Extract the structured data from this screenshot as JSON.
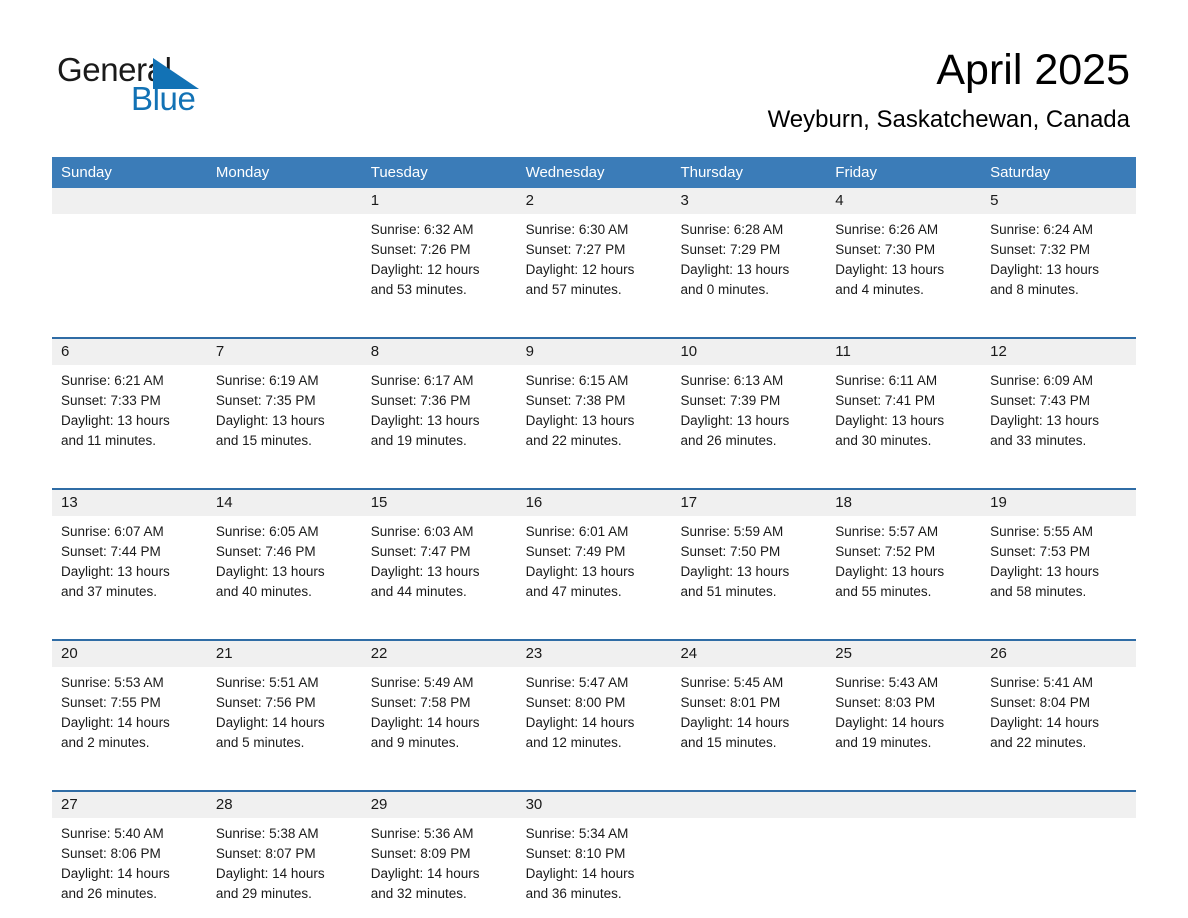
{
  "logo": {
    "word_one": "General",
    "word_two": "Blue",
    "triangle_color": "#1272b5",
    "text_color": "#1a1a1a"
  },
  "header": {
    "title": "April 2025",
    "location": "Weyburn, Saskatchewan, Canada"
  },
  "colors": {
    "header_band": "#3b7cb8",
    "row_divider": "#2f6ca5",
    "day_number_band": "#f0f0f0",
    "text": "#1a1a1a"
  },
  "weekdays": [
    "Sunday",
    "Monday",
    "Tuesday",
    "Wednesday",
    "Thursday",
    "Friday",
    "Saturday"
  ],
  "weeks": [
    [
      {
        "day": "",
        "lines": []
      },
      {
        "day": "",
        "lines": []
      },
      {
        "day": "1",
        "lines": [
          "Sunrise: 6:32 AM",
          "Sunset: 7:26 PM",
          "Daylight: 12 hours",
          "and 53 minutes."
        ]
      },
      {
        "day": "2",
        "lines": [
          "Sunrise: 6:30 AM",
          "Sunset: 7:27 PM",
          "Daylight: 12 hours",
          "and 57 minutes."
        ]
      },
      {
        "day": "3",
        "lines": [
          "Sunrise: 6:28 AM",
          "Sunset: 7:29 PM",
          "Daylight: 13 hours",
          "and 0 minutes."
        ]
      },
      {
        "day": "4",
        "lines": [
          "Sunrise: 6:26 AM",
          "Sunset: 7:30 PM",
          "Daylight: 13 hours",
          "and 4 minutes."
        ]
      },
      {
        "day": "5",
        "lines": [
          "Sunrise: 6:24 AM",
          "Sunset: 7:32 PM",
          "Daylight: 13 hours",
          "and 8 minutes."
        ]
      }
    ],
    [
      {
        "day": "6",
        "lines": [
          "Sunrise: 6:21 AM",
          "Sunset: 7:33 PM",
          "Daylight: 13 hours",
          "and 11 minutes."
        ]
      },
      {
        "day": "7",
        "lines": [
          "Sunrise: 6:19 AM",
          "Sunset: 7:35 PM",
          "Daylight: 13 hours",
          "and 15 minutes."
        ]
      },
      {
        "day": "8",
        "lines": [
          "Sunrise: 6:17 AM",
          "Sunset: 7:36 PM",
          "Daylight: 13 hours",
          "and 19 minutes."
        ]
      },
      {
        "day": "9",
        "lines": [
          "Sunrise: 6:15 AM",
          "Sunset: 7:38 PM",
          "Daylight: 13 hours",
          "and 22 minutes."
        ]
      },
      {
        "day": "10",
        "lines": [
          "Sunrise: 6:13 AM",
          "Sunset: 7:39 PM",
          "Daylight: 13 hours",
          "and 26 minutes."
        ]
      },
      {
        "day": "11",
        "lines": [
          "Sunrise: 6:11 AM",
          "Sunset: 7:41 PM",
          "Daylight: 13 hours",
          "and 30 minutes."
        ]
      },
      {
        "day": "12",
        "lines": [
          "Sunrise: 6:09 AM",
          "Sunset: 7:43 PM",
          "Daylight: 13 hours",
          "and 33 minutes."
        ]
      }
    ],
    [
      {
        "day": "13",
        "lines": [
          "Sunrise: 6:07 AM",
          "Sunset: 7:44 PM",
          "Daylight: 13 hours",
          "and 37 minutes."
        ]
      },
      {
        "day": "14",
        "lines": [
          "Sunrise: 6:05 AM",
          "Sunset: 7:46 PM",
          "Daylight: 13 hours",
          "and 40 minutes."
        ]
      },
      {
        "day": "15",
        "lines": [
          "Sunrise: 6:03 AM",
          "Sunset: 7:47 PM",
          "Daylight: 13 hours",
          "and 44 minutes."
        ]
      },
      {
        "day": "16",
        "lines": [
          "Sunrise: 6:01 AM",
          "Sunset: 7:49 PM",
          "Daylight: 13 hours",
          "and 47 minutes."
        ]
      },
      {
        "day": "17",
        "lines": [
          "Sunrise: 5:59 AM",
          "Sunset: 7:50 PM",
          "Daylight: 13 hours",
          "and 51 minutes."
        ]
      },
      {
        "day": "18",
        "lines": [
          "Sunrise: 5:57 AM",
          "Sunset: 7:52 PM",
          "Daylight: 13 hours",
          "and 55 minutes."
        ]
      },
      {
        "day": "19",
        "lines": [
          "Sunrise: 5:55 AM",
          "Sunset: 7:53 PM",
          "Daylight: 13 hours",
          "and 58 minutes."
        ]
      }
    ],
    [
      {
        "day": "20",
        "lines": [
          "Sunrise: 5:53 AM",
          "Sunset: 7:55 PM",
          "Daylight: 14 hours",
          "and 2 minutes."
        ]
      },
      {
        "day": "21",
        "lines": [
          "Sunrise: 5:51 AM",
          "Sunset: 7:56 PM",
          "Daylight: 14 hours",
          "and 5 minutes."
        ]
      },
      {
        "day": "22",
        "lines": [
          "Sunrise: 5:49 AM",
          "Sunset: 7:58 PM",
          "Daylight: 14 hours",
          "and 9 minutes."
        ]
      },
      {
        "day": "23",
        "lines": [
          "Sunrise: 5:47 AM",
          "Sunset: 8:00 PM",
          "Daylight: 14 hours",
          "and 12 minutes."
        ]
      },
      {
        "day": "24",
        "lines": [
          "Sunrise: 5:45 AM",
          "Sunset: 8:01 PM",
          "Daylight: 14 hours",
          "and 15 minutes."
        ]
      },
      {
        "day": "25",
        "lines": [
          "Sunrise: 5:43 AM",
          "Sunset: 8:03 PM",
          "Daylight: 14 hours",
          "and 19 minutes."
        ]
      },
      {
        "day": "26",
        "lines": [
          "Sunrise: 5:41 AM",
          "Sunset: 8:04 PM",
          "Daylight: 14 hours",
          "and 22 minutes."
        ]
      }
    ],
    [
      {
        "day": "27",
        "lines": [
          "Sunrise: 5:40 AM",
          "Sunset: 8:06 PM",
          "Daylight: 14 hours",
          "and 26 minutes."
        ]
      },
      {
        "day": "28",
        "lines": [
          "Sunrise: 5:38 AM",
          "Sunset: 8:07 PM",
          "Daylight: 14 hours",
          "and 29 minutes."
        ]
      },
      {
        "day": "29",
        "lines": [
          "Sunrise: 5:36 AM",
          "Sunset: 8:09 PM",
          "Daylight: 14 hours",
          "and 32 minutes."
        ]
      },
      {
        "day": "30",
        "lines": [
          "Sunrise: 5:34 AM",
          "Sunset: 8:10 PM",
          "Daylight: 14 hours",
          "and 36 minutes."
        ]
      },
      {
        "day": "",
        "lines": []
      },
      {
        "day": "",
        "lines": []
      },
      {
        "day": "",
        "lines": []
      }
    ]
  ]
}
